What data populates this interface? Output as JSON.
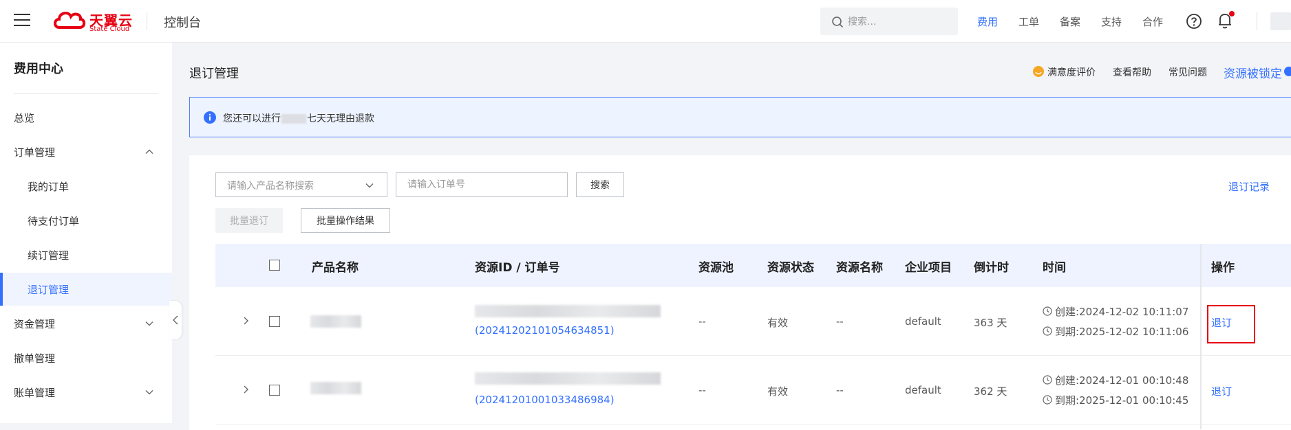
{
  "header": {
    "brand_cn": "天翼云",
    "brand_en": "State Cloud",
    "console": "控制台",
    "search_placeholder": "搜索...",
    "nav": [
      "费用",
      "工单",
      "备案",
      "支持",
      "合作"
    ],
    "active_nav": "费用",
    "accent_color": "#3370ff",
    "brand_color": "#e60012"
  },
  "sidebar": {
    "title": "费用中心",
    "items": [
      {
        "label": "总览",
        "level": "top"
      },
      {
        "label": "订单管理",
        "level": "top",
        "expanded": true
      },
      {
        "label": "我的订单",
        "level": "sub"
      },
      {
        "label": "待支付订单",
        "level": "sub"
      },
      {
        "label": "续订管理",
        "level": "sub"
      },
      {
        "label": "退订管理",
        "level": "sub",
        "active": true
      },
      {
        "label": "资金管理",
        "level": "top",
        "expanded": false
      },
      {
        "label": "撤单管理",
        "level": "top"
      },
      {
        "label": "账单管理",
        "level": "top",
        "expanded": false
      }
    ]
  },
  "main": {
    "title": "退订管理",
    "links": [
      "满意度评价",
      "查看帮助",
      "常见问题"
    ],
    "locked_link": "资源被锁定",
    "notice_prefix": "您还可以进行",
    "notice_suffix": "七天无理由退款",
    "filter": {
      "product_placeholder": "请输入产品名称搜索",
      "order_placeholder": "请输入订单号",
      "search_label": "搜索",
      "batch_unsubscribe": "批量退订",
      "batch_results": "批量操作结果",
      "record_link": "退订记录"
    },
    "table": {
      "columns": [
        "产品名称",
        "资源ID / 订单号",
        "资源池",
        "资源状态",
        "资源名称",
        "企业项目",
        "倒计时",
        "时间",
        "操作"
      ],
      "rows": [
        {
          "order_no": "(20241202101054634851)",
          "pool": "--",
          "status": "有效",
          "name": "--",
          "project": "default",
          "countdown": "363 天",
          "created": "创建:2024-12-02 10:11:07",
          "expires": "到期:2025-12-02 10:11:06",
          "action": "退订"
        },
        {
          "order_no": "(20241201001033486984)",
          "pool": "--",
          "status": "有效",
          "name": "--",
          "project": "default",
          "countdown": "362 天",
          "created": "创建:2024-12-01 00:10:48",
          "expires": "到期:2025-12-01 00:10:45",
          "action": "退订"
        }
      ]
    }
  }
}
